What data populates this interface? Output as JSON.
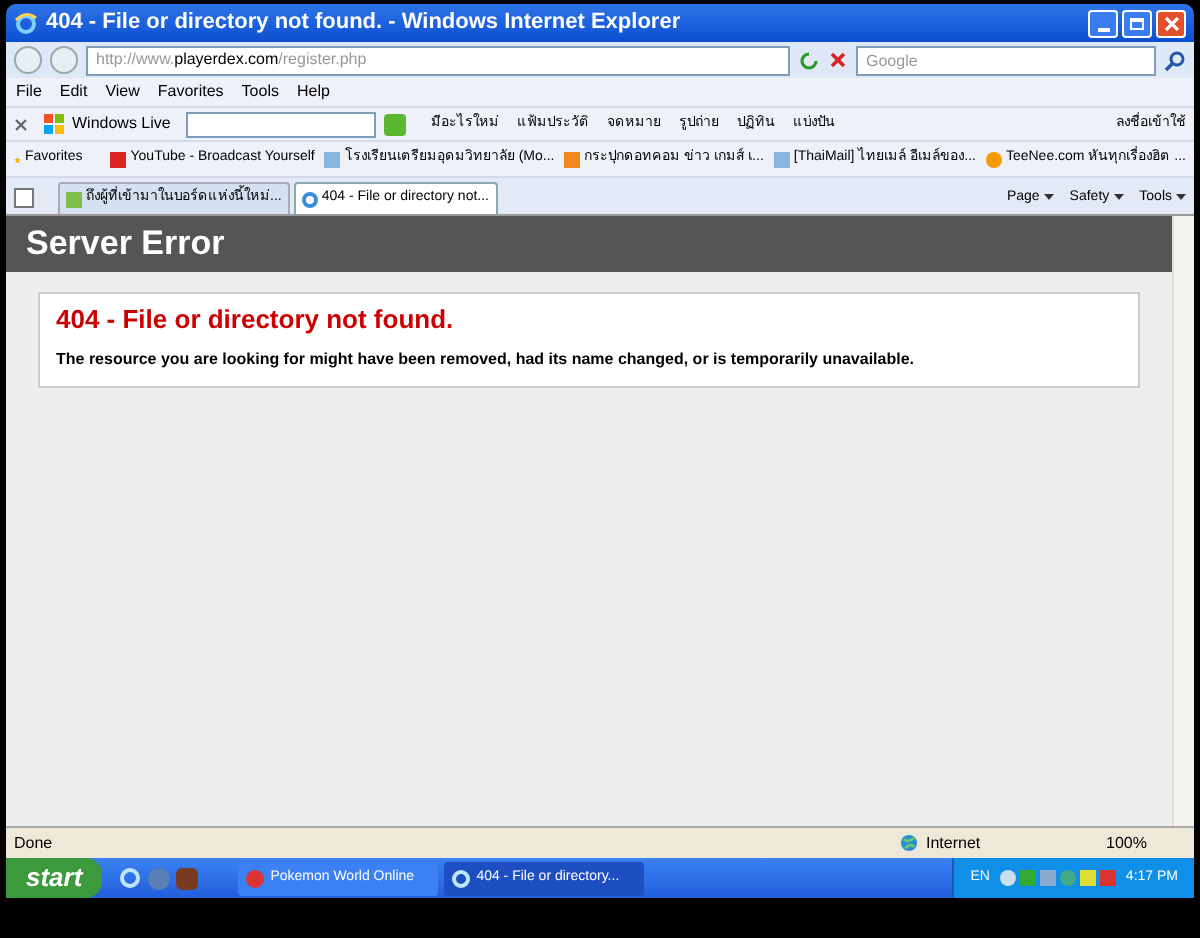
{
  "window": {
    "title": "404 - File or directory not found. - Windows Internet Explorer"
  },
  "address": {
    "segments": [
      {
        "text": "http://www.",
        "strong": false
      },
      {
        "text": "playerdex.com",
        "strong": true
      },
      {
        "text": "/register.php",
        "strong": false
      }
    ]
  },
  "search": {
    "placeholder": "Google"
  },
  "menu": [
    "File",
    "Edit",
    "View",
    "Favorites",
    "Tools",
    "Help"
  ],
  "live_toolbar": {
    "brand": "Windows Live",
    "links": [
      "มีอะไรใหม่",
      "แฟ้มประวัติ",
      "จดหมาย",
      "รูปถ่าย",
      "ปฏิทิน",
      "แบ่งปัน"
    ],
    "sign_in": "ลงชื่อเข้าใช้"
  },
  "favorites": {
    "label": "Favorites",
    "items": [
      {
        "label": "YouTube - Broadcast Yourself",
        "kind": "youtube"
      },
      {
        "label": "โรงเรียนเตรียมอุดมวิทยาลัย (Mo...",
        "kind": "page"
      },
      {
        "label": "กระปุกดอทคอม ข่าว เกมส์ เ...",
        "kind": "kapook"
      },
      {
        "label": "[ThaiMail] ไทยเมล์ อีเมล์ของ...",
        "kind": "page"
      },
      {
        "label": "TeeNee.com หันทุกเรื่องฮิต ...",
        "kind": "teenee"
      }
    ]
  },
  "tabs": [
    {
      "label": "ถึงผู้ที่เข้ามาในบอร์ดแห่งนี้ใหม่...",
      "selected": false
    },
    {
      "label": "404 - File or directory not...",
      "selected": true
    }
  ],
  "command_bar": [
    "Page",
    "Safety",
    "Tools"
  ],
  "page": {
    "header": "Server Error",
    "error_title": "404 - File or directory not found.",
    "error_message": "The resource you are looking for might have been removed, had its name changed, or is temporarily unavailable."
  },
  "status_bar": {
    "text": "Done",
    "zone": "Internet",
    "zoom": "100%"
  },
  "taskbar": {
    "start": "start",
    "tasks": [
      {
        "label": "Pokemon World Online",
        "selected": false
      },
      {
        "label": "404 - File or directory...",
        "selected": true
      }
    ],
    "language": "EN",
    "clock": "4:17 PM"
  }
}
